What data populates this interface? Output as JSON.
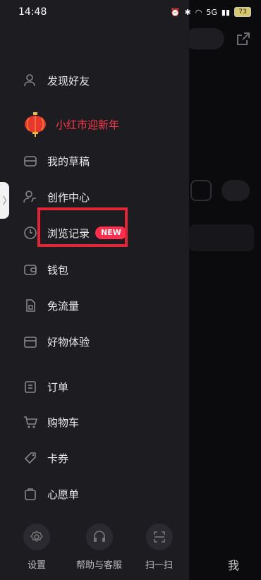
{
  "status_bar": {
    "time": "14:48",
    "network_label": "5G",
    "battery_level": "73"
  },
  "drawer": {
    "find_friends": "发现好友",
    "festival_banner": "小红市迎新年",
    "items": [
      {
        "label": "我的草稿",
        "icon": "draft-box-icon"
      },
      {
        "label": "创作中心",
        "icon": "creator-center-icon"
      },
      {
        "label": "浏览记录",
        "icon": "history-clock-icon",
        "badge": "NEW"
      },
      {
        "label": "钱包",
        "icon": "wallet-icon"
      },
      {
        "label": "免流量",
        "icon": "sim-card-icon"
      },
      {
        "label": "好物体验",
        "icon": "store-icon"
      },
      {
        "label": "订单",
        "icon": "order-list-icon"
      },
      {
        "label": "购物车",
        "icon": "shopping-cart-icon"
      },
      {
        "label": "卡券",
        "icon": "coupon-icon"
      },
      {
        "label": "心愿单",
        "icon": "wishlist-icon"
      }
    ]
  },
  "bottom_actions": {
    "settings": "设置",
    "help": "帮助与客服",
    "scan": "扫一扫"
  },
  "background_page": {
    "tab_me": "我"
  },
  "colors": {
    "accent": "#ff2e4d",
    "highlight": "#e02636",
    "drawer_bg": "#1c1c21"
  }
}
